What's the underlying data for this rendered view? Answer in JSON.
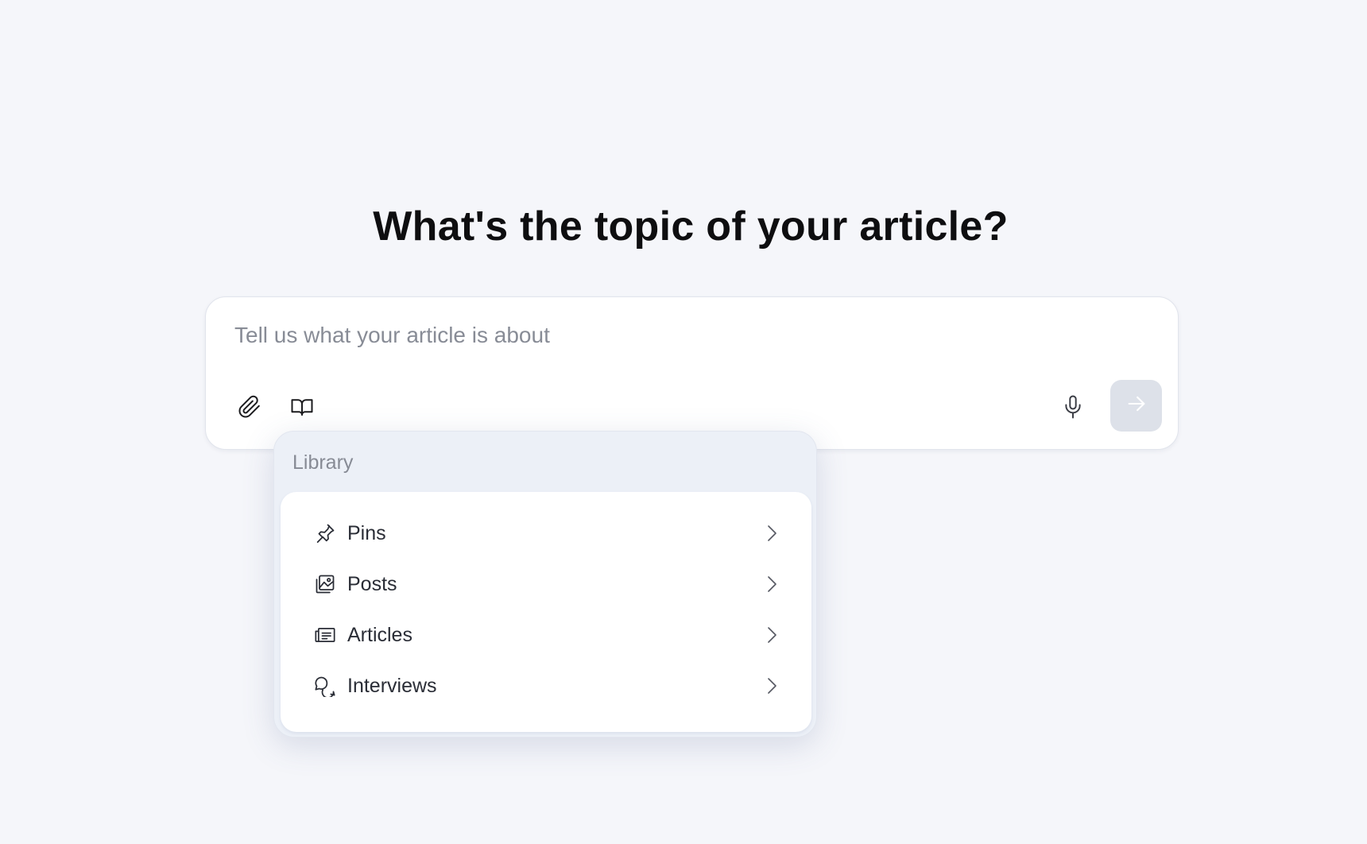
{
  "heading": "What's the topic of your article?",
  "composer": {
    "placeholder": "Tell us what your article is about",
    "value": "",
    "tools": {
      "attach_icon": "paperclip-icon",
      "library_icon": "book-open-icon",
      "mic_icon": "microphone-icon",
      "send_icon": "arrow-right-icon"
    }
  },
  "library_menu": {
    "header": "Library",
    "items": [
      {
        "label": "Pins",
        "icon": "pin-icon"
      },
      {
        "label": "Posts",
        "icon": "image-stack-icon"
      },
      {
        "label": "Articles",
        "icon": "newspaper-icon"
      },
      {
        "label": "Interviews",
        "icon": "chat-bubbles-icon"
      }
    ]
  },
  "colors": {
    "background": "#f5f6fa",
    "send_button_disabled": "#dde1e9",
    "popover_background": "#ecf0f7",
    "placeholder_text": "#888c96"
  }
}
